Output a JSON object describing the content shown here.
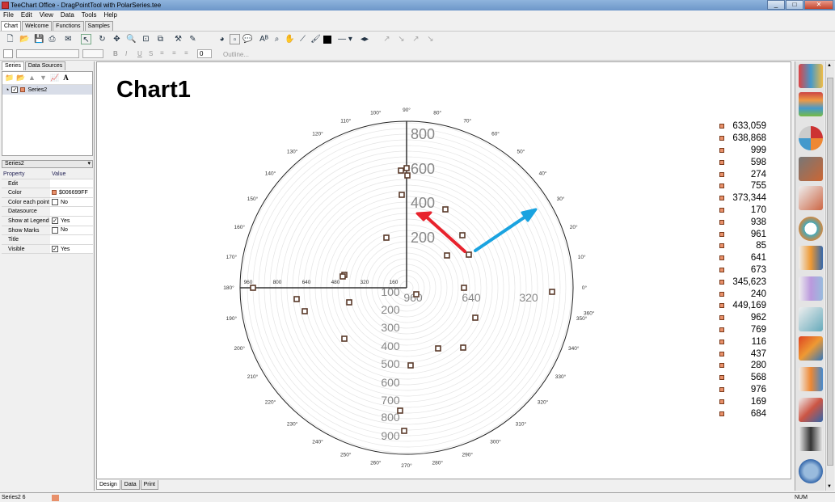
{
  "window": {
    "title": "TeeChart Office - DragPointTool with PolarSeries.tee",
    "min": "_",
    "max": "□",
    "close": "✕"
  },
  "menu": [
    "File",
    "Edit",
    "View",
    "Data",
    "Tools",
    "Help"
  ],
  "main_tabs": [
    "Chart",
    "Welcome",
    "Functions",
    "Samples"
  ],
  "format_toolbar": {
    "font_size_value": "0",
    "outline_label": "Outline..."
  },
  "left": {
    "tabs": [
      "Series",
      "Data Sources"
    ],
    "series_item": "Series2",
    "series_combo": "Series2",
    "prop_headers": {
      "property": "Property",
      "value": "Value"
    },
    "props": [
      {
        "k": "Edit",
        "v": "",
        "type": "none"
      },
      {
        "k": "Color",
        "v": "$006699FF",
        "type": "color"
      },
      {
        "k": "Color each point",
        "v": "No",
        "type": "check",
        "checked": false
      },
      {
        "k": "Datasource",
        "v": "",
        "type": "none"
      },
      {
        "k": "Show at Legend",
        "v": "Yes",
        "type": "check",
        "checked": true
      },
      {
        "k": "Show Marks",
        "v": "No",
        "type": "check",
        "checked": false
      },
      {
        "k": "Title",
        "v": "",
        "type": "none"
      },
      {
        "k": "Visible",
        "v": "Yes",
        "type": "check",
        "checked": true
      }
    ]
  },
  "chart": {
    "title": "Chart1",
    "angle_labels": [
      "0°",
      "10°",
      "20°",
      "30°",
      "40°",
      "50°",
      "60°",
      "70°",
      "80°",
      "90°",
      "100°",
      "110°",
      "120°",
      "130°",
      "140°",
      "150°",
      "160°",
      "170°",
      "180°",
      "190°",
      "200°",
      "210°",
      "220°",
      "230°",
      "240°",
      "250°",
      "260°",
      "270°",
      "280°",
      "290°",
      "300°",
      "310°",
      "320°",
      "330°",
      "340°",
      "350°",
      "360°"
    ],
    "radius_labels_up": [
      "200",
      "400",
      "600",
      "800"
    ],
    "radius_labels_down": [
      "100",
      "200",
      "300",
      "400",
      "500",
      "600",
      "700",
      "800",
      "900"
    ],
    "radius_labels_right": [
      "960",
      "640",
      "320"
    ],
    "radius_labels_left": [
      "960",
      "800",
      "640",
      "480",
      "320",
      "160"
    ],
    "legend": [
      "633,059",
      "638,868",
      "999",
      "598",
      "274",
      "755",
      "373,344",
      "170",
      "938",
      "961",
      "85",
      "641",
      "673",
      "345,623",
      "240",
      "449,169",
      "962",
      "769",
      "116",
      "437",
      "280",
      "568",
      "976",
      "169",
      "684"
    ],
    "colors": {
      "point": "#e8906a",
      "arrow_red": "#e8232d",
      "arrow_blue": "#1aa3e0"
    }
  },
  "chart_data": {
    "type": "scatter",
    "title": "Chart1",
    "series": [
      {
        "name": "Series2",
        "values": [
          633059,
          638868,
          999,
          598,
          274,
          755,
          373344,
          170,
          938,
          961,
          85,
          641,
          673,
          345623,
          240,
          449169,
          962,
          769,
          116,
          437,
          280,
          568,
          976,
          169,
          684
        ]
      }
    ],
    "angle_range": [
      0,
      360
    ]
  },
  "bottom_tabs": [
    "Design",
    "Data",
    "Print"
  ],
  "status": {
    "left": "Series2 6",
    "right": "NUM"
  }
}
